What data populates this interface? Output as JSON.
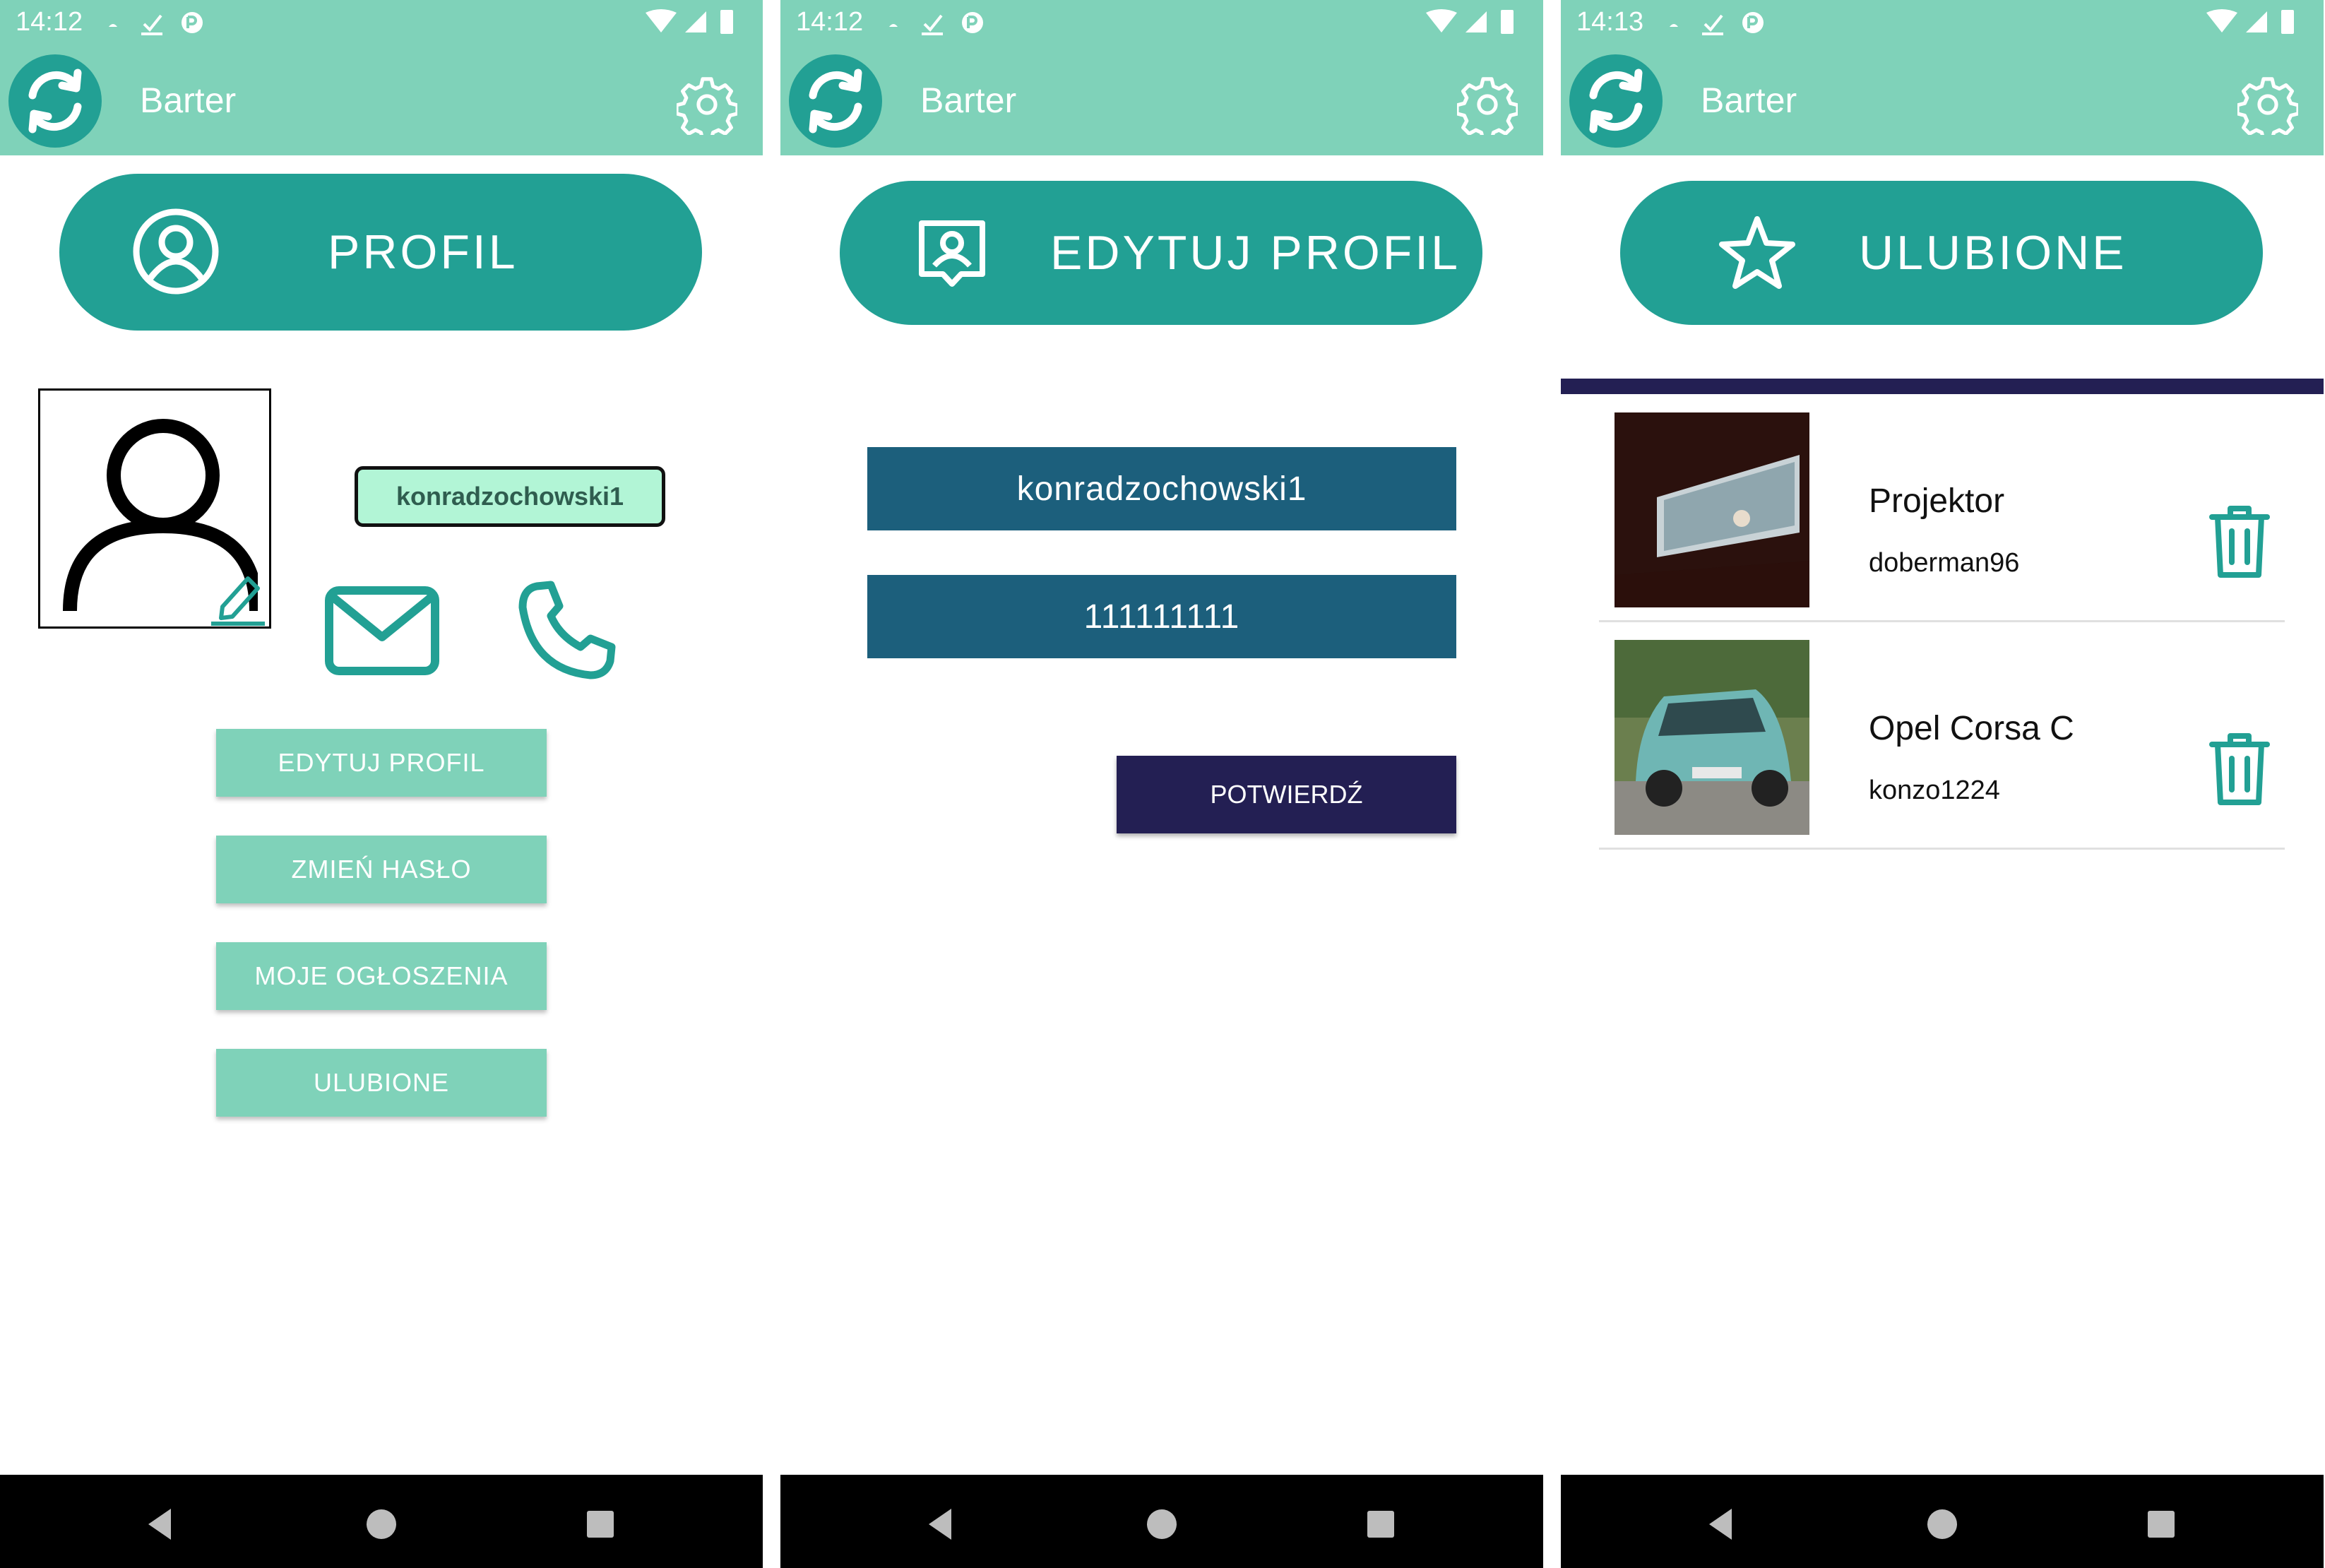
{
  "colors": {
    "primary_light": "#7fd2b9",
    "primary": "#22a094",
    "field": "#1c5f7c",
    "dark_accent": "#231f53",
    "chip_bg": "#b2f5d6"
  },
  "screens": [
    {
      "status": {
        "time": "14:12"
      },
      "appbar": {
        "title": "Barter",
        "logo_icon": "sync-icon",
        "settings_icon": "gear-icon"
      },
      "hero": {
        "label": "PROFIL",
        "icon": "user-circle-icon"
      },
      "profile": {
        "username": "konradzochowski1",
        "avatar_icon": "user-icon",
        "edit_icon": "pencil-icon",
        "mail_icon": "mail-icon",
        "phone_icon": "phone-icon"
      },
      "menu": [
        "EDYTUJ PROFIL",
        "ZMIEŃ HASŁO",
        "MOJE OGŁOSZENIA",
        "ULUBIONE"
      ]
    },
    {
      "status": {
        "time": "14:12"
      },
      "appbar": {
        "title": "Barter",
        "logo_icon": "sync-icon",
        "settings_icon": "gear-icon"
      },
      "hero": {
        "label": "EDYTUJ PROFIL",
        "icon": "contact-card-icon"
      },
      "form": {
        "username": "konradzochowski1",
        "phone": "111111111",
        "confirm": "POTWIERDŹ"
      }
    },
    {
      "status": {
        "time": "14:13"
      },
      "appbar": {
        "title": "Barter",
        "logo_icon": "sync-icon",
        "settings_icon": "gear-icon"
      },
      "hero": {
        "label": "ULUBIONE",
        "icon": "star-icon"
      },
      "favorites": [
        {
          "title": "Projektor",
          "user": "doberman96",
          "image": "projector-photo"
        },
        {
          "title": "Opel Corsa C",
          "user": "konzo1224",
          "image": "car-photo"
        }
      ]
    }
  ]
}
